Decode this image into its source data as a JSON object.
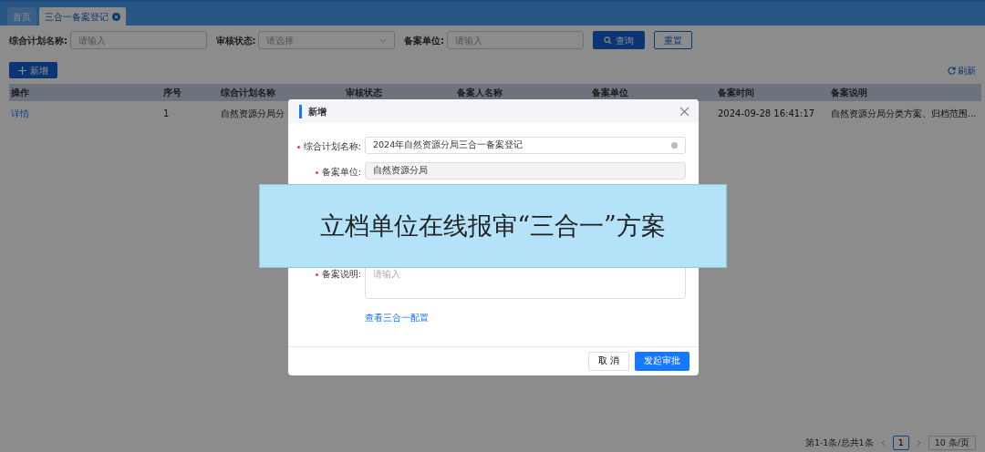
{
  "tabs": [
    {
      "label": "首页",
      "selected": false,
      "closable": false
    },
    {
      "label": "三合一备案登记",
      "selected": true,
      "closable": true
    }
  ],
  "filters": [
    {
      "kind": "input",
      "label": "综合计划名称:",
      "placeholder": "请输入"
    },
    {
      "kind": "select",
      "label": "审核状态:",
      "placeholder": "请选择"
    },
    {
      "kind": "input",
      "label": "备案单位:",
      "placeholder": "请输入"
    }
  ],
  "search_button": "查询",
  "reset_button": "重置",
  "add_button": "新增",
  "refresh_link": "刷新",
  "table": {
    "columns": [
      "操作",
      "序号",
      "综合计划名称",
      "审核状态",
      "备案人名称",
      "备案单位",
      "备案时间",
      "备案说明"
    ],
    "rows": [
      [
        "详情",
        "1",
        "自然资源分局分",
        "",
        "",
        "",
        "2024-09-28 16:41:17",
        "自然资源分局分类方案、归档范围..."
      ]
    ]
  },
  "pagination": {
    "summary": "第1-1条/总共1条",
    "pages": [
      {
        "label": "1",
        "selected": true
      }
    ],
    "page_size": "10 条/页"
  },
  "dialog": {
    "title": "新增",
    "fields": [
      {
        "kind": "input",
        "label": "综合计划名称:",
        "required": true,
        "value": "2024年自然资源分局三合一备案登记",
        "disabled": false
      },
      {
        "kind": "input",
        "label": "备案单位:",
        "required": true,
        "value": "自然资源分局",
        "disabled": true
      },
      {
        "kind": "hidden"
      },
      {
        "kind": "hidden"
      },
      {
        "kind": "hidden"
      },
      {
        "kind": "textarea",
        "label": "备案说明:",
        "required": true,
        "placeholder": "请输入"
      }
    ],
    "link": "查看三合一配置",
    "cancel_button": "取 消",
    "submit_button": "发起审批"
  },
  "caption": "立档单位在线报审“三合一”方案"
}
